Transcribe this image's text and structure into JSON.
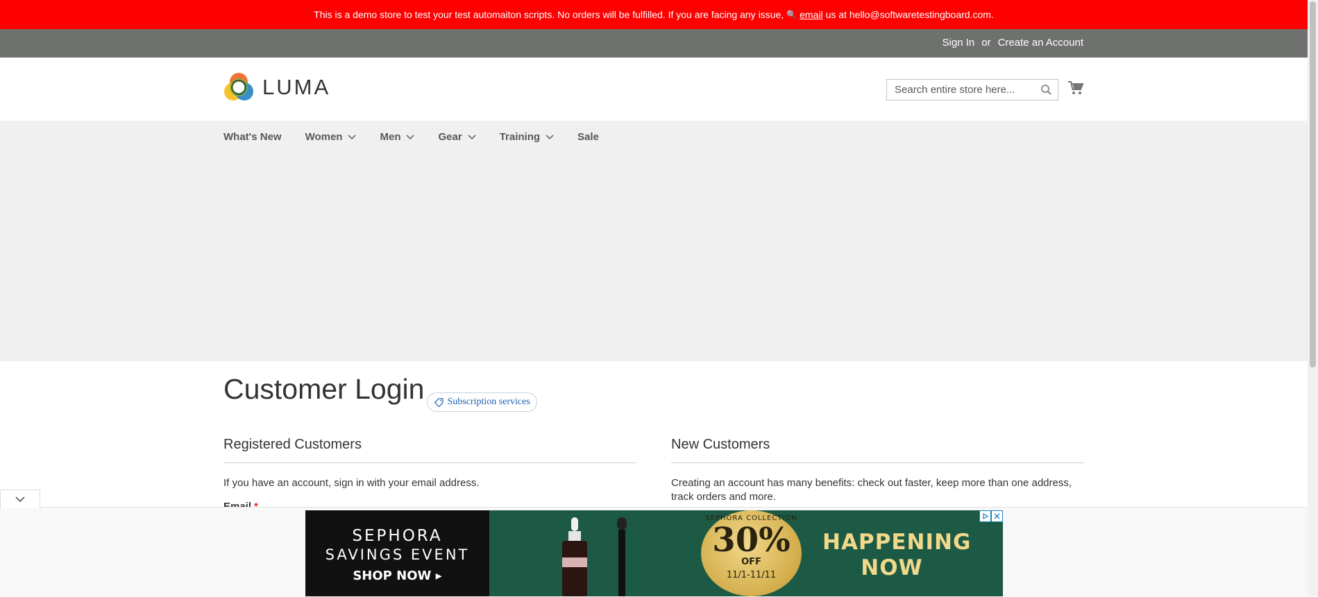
{
  "banner": {
    "text_before": "This is a demo store to test your test automaiton scripts. No orders will be fulfilled. If you are facing any issue,",
    "key_icon": "🔍",
    "link": "email",
    "text_after": "us at hello@softwaretestingboard.com."
  },
  "account_links": {
    "sign_in": "Sign In",
    "or": "or",
    "create": "Create an Account"
  },
  "brand": {
    "name": "LUMA"
  },
  "search": {
    "placeholder": "Search entire store here..."
  },
  "nav": {
    "items": [
      {
        "label": "What's New"
      },
      {
        "label": "Women"
      },
      {
        "label": "Men"
      },
      {
        "label": "Gear"
      },
      {
        "label": "Training"
      },
      {
        "label": "Sale"
      }
    ]
  },
  "page": {
    "title": "Customer Login",
    "badge": "Subscription services"
  },
  "registered": {
    "heading": "Registered Customers",
    "text": "If you have an account, sign in with your email address.",
    "email_label": "Email",
    "required_mark": "*"
  },
  "new_customers": {
    "heading": "New Customers",
    "text": "Creating an account has many benefits: check out faster, keep more than one address, track orders and more."
  },
  "ad": {
    "line1": "SEPHORA",
    "line2": "SAVINGS EVENT",
    "line3": "SHOP NOW ▸",
    "coin_top": "SEPHORA COLLECTION",
    "percent": "30%",
    "off": "OFF",
    "dates": "11/1-11/11",
    "headline1": "HAPPENING",
    "headline2": "NOW"
  },
  "colors": {
    "banner": "#ff0000",
    "topbar": "#6e716e",
    "nav_bg": "#f0f0f0",
    "ad_green": "#1c5a45",
    "gold": "#f1d88a"
  }
}
